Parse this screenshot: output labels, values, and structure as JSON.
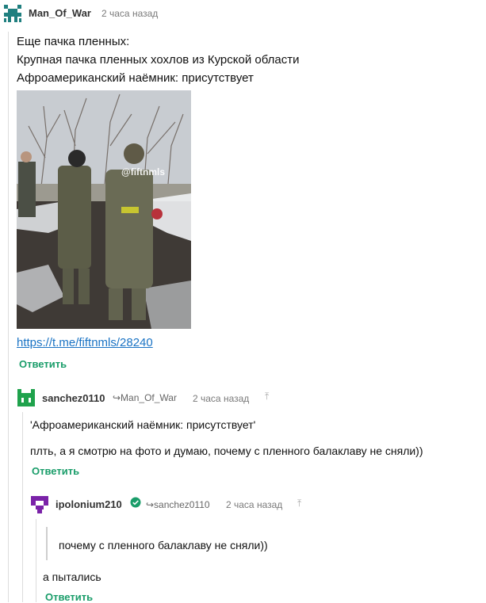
{
  "comment1": {
    "username": "Man_Of_War",
    "time": "2 часа назад",
    "lines": [
      "Еще пачка пленных:",
      "Крупная пачка пленных хохлов из Курской области",
      "Афроамериканский наёмник: присутствует"
    ],
    "watermark": "@fiftnmls",
    "link": "https://t.me/fiftnmls/28240",
    "reply_label": "Ответить"
  },
  "comment2": {
    "username": "sanchez0110",
    "reply_to": "↪Man_Of_War",
    "time": "2 часа назад",
    "quote": "'Афроамериканский наёмник: присутствует'",
    "text": "плть, а я смотрю на фото и думаю, почему с пленного балаклаву не сняли))",
    "reply_label": "Ответить"
  },
  "comment3": {
    "username": "ipolonium210",
    "reply_to": "↪sanchez0110",
    "time": "2 часа назад",
    "quote": "почему с пленного балаклаву не сняли))",
    "text": "а пытались",
    "reply_label": "Ответить"
  },
  "colors": {
    "accent": "#1a9d6a",
    "link": "#1a73c4",
    "avatar1": "#1f7f7f",
    "avatar2": "#1fa24c",
    "avatar3": "#7a22a8"
  },
  "icons": {
    "reply_arrow": "reply-arrow-icon",
    "up": "arrow-up-icon",
    "verified": "verified-badge-icon"
  }
}
